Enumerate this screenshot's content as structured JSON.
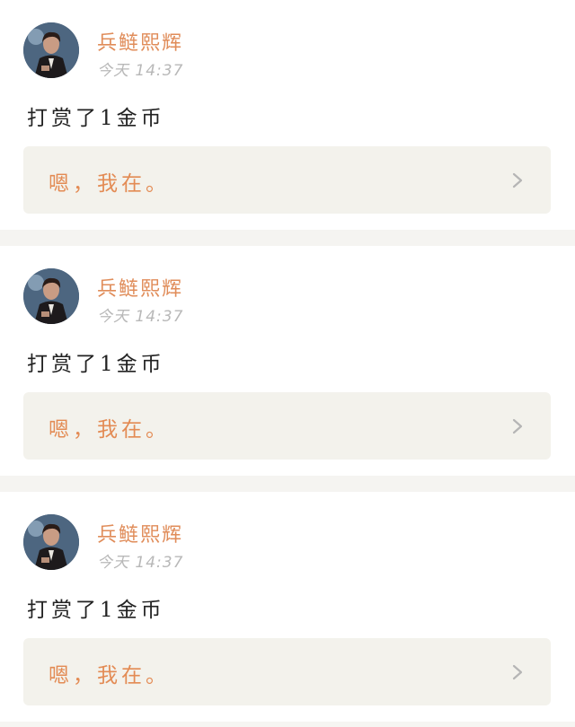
{
  "posts": [
    {
      "user": "兵鲢熙辉",
      "time": "今天 14:37",
      "action": "打赏了1金币",
      "reply": "嗯，我在。"
    },
    {
      "user": "兵鲢熙辉",
      "time": "今天 14:37",
      "action": "打赏了1金币",
      "reply": "嗯，我在。"
    },
    {
      "user": "兵鲢熙辉",
      "time": "今天 14:37",
      "action": "打赏了1金币",
      "reply": "嗯，我在。"
    }
  ],
  "icons": {
    "avatar": "avatar-man-in-suit",
    "arrow": "chevron-right-icon"
  },
  "colors": {
    "username": "#e08c59",
    "reply": "#e38b54",
    "timestamp": "#b8b8b8",
    "reply_bg": "#f3f2ec",
    "page_bg": "#f6f5f2"
  }
}
